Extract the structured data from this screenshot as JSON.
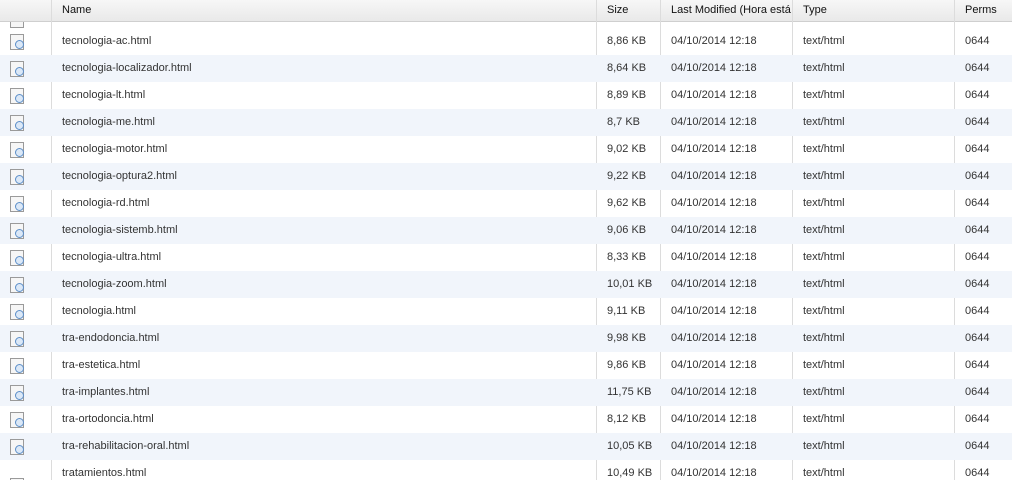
{
  "columns": {
    "name": "Name",
    "size": "Size",
    "modified": "Last Modified (Hora está",
    "type": "Type",
    "perms": "Perms"
  },
  "icons": {
    "file": "html-file-icon"
  },
  "rows": [
    {
      "name": "tecnologia-ac.html",
      "size": "8,86 KB",
      "modified": "04/10/2014 12:18",
      "type": "text/html",
      "perms": "0644"
    },
    {
      "name": "tecnologia-localizador.html",
      "size": "8,64 KB",
      "modified": "04/10/2014 12:18",
      "type": "text/html",
      "perms": "0644"
    },
    {
      "name": "tecnologia-lt.html",
      "size": "8,89 KB",
      "modified": "04/10/2014 12:18",
      "type": "text/html",
      "perms": "0644"
    },
    {
      "name": "tecnologia-me.html",
      "size": "8,7 KB",
      "modified": "04/10/2014 12:18",
      "type": "text/html",
      "perms": "0644"
    },
    {
      "name": "tecnologia-motor.html",
      "size": "9,02 KB",
      "modified": "04/10/2014 12:18",
      "type": "text/html",
      "perms": "0644"
    },
    {
      "name": "tecnologia-optura2.html",
      "size": "9,22 KB",
      "modified": "04/10/2014 12:18",
      "type": "text/html",
      "perms": "0644"
    },
    {
      "name": "tecnologia-rd.html",
      "size": "9,62 KB",
      "modified": "04/10/2014 12:18",
      "type": "text/html",
      "perms": "0644"
    },
    {
      "name": "tecnologia-sistemb.html",
      "size": "9,06 KB",
      "modified": "04/10/2014 12:18",
      "type": "text/html",
      "perms": "0644"
    },
    {
      "name": "tecnologia-ultra.html",
      "size": "8,33 KB",
      "modified": "04/10/2014 12:18",
      "type": "text/html",
      "perms": "0644"
    },
    {
      "name": "tecnologia-zoom.html",
      "size": "10,01 KB",
      "modified": "04/10/2014 12:18",
      "type": "text/html",
      "perms": "0644"
    },
    {
      "name": "tecnologia.html",
      "size": "9,11 KB",
      "modified": "04/10/2014 12:18",
      "type": "text/html",
      "perms": "0644"
    },
    {
      "name": "tra-endodoncia.html",
      "size": "9,98 KB",
      "modified": "04/10/2014 12:18",
      "type": "text/html",
      "perms": "0644"
    },
    {
      "name": "tra-estetica.html",
      "size": "9,86 KB",
      "modified": "04/10/2014 12:18",
      "type": "text/html",
      "perms": "0644"
    },
    {
      "name": "tra-implantes.html",
      "size": "11,75 KB",
      "modified": "04/10/2014 12:18",
      "type": "text/html",
      "perms": "0644"
    },
    {
      "name": "tra-ortodoncia.html",
      "size": "8,12 KB",
      "modified": "04/10/2014 12:18",
      "type": "text/html",
      "perms": "0644"
    },
    {
      "name": "tra-rehabilitacion-oral.html",
      "size": "10,05 KB",
      "modified": "04/10/2014 12:18",
      "type": "text/html",
      "perms": "0644"
    },
    {
      "name": "tratamientos.html",
      "size": "10,49 KB",
      "modified": "04/10/2014 12:18",
      "type": "text/html",
      "perms": "0644"
    }
  ]
}
